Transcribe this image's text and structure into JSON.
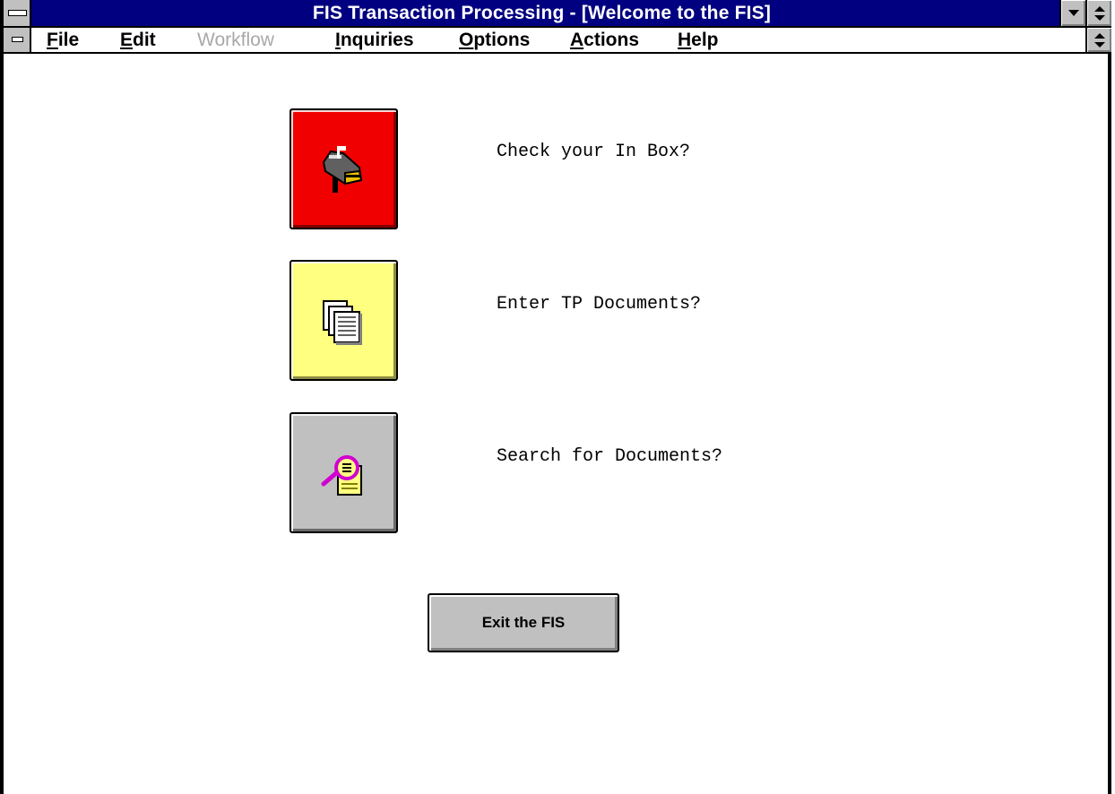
{
  "window": {
    "title": "FIS Transaction Processing - [Welcome to the FIS]"
  },
  "titlebar_buttons": {
    "minimize_icon": "down-triangle-icon",
    "maximize_icon": "up-down-arrows-icon"
  },
  "menubar": {
    "items": [
      {
        "label": "File",
        "mnemonic": "F",
        "rest": "ile",
        "enabled": true
      },
      {
        "label": "Edit",
        "mnemonic": "E",
        "rest": "dit",
        "enabled": true
      },
      {
        "label": "Workflow",
        "enabled": false
      },
      {
        "label": "Inquiries",
        "mnemonic": "I",
        "rest": "nquiries",
        "enabled": true
      },
      {
        "label": "Options",
        "mnemonic": "O",
        "rest": "ptions",
        "enabled": true
      },
      {
        "label": "Actions",
        "mnemonic": "A",
        "rest": "ctions",
        "enabled": true
      },
      {
        "label": "Help",
        "mnemonic": "H",
        "rest": "elp",
        "enabled": true
      }
    ]
  },
  "main": {
    "actions": [
      {
        "label": "Check your In Box?",
        "icon": "mailbox-icon",
        "color": "#f00000"
      },
      {
        "label": "Enter TP Documents?",
        "icon": "documents-icon",
        "color": "#ffff80"
      },
      {
        "label": "Search for Documents?",
        "icon": "magnifier-document-icon",
        "color": "#c0c0c0"
      }
    ],
    "exit_label": "Exit the FIS"
  },
  "colors": {
    "titlebar": "#000080",
    "chrome": "#c0c0c0"
  }
}
